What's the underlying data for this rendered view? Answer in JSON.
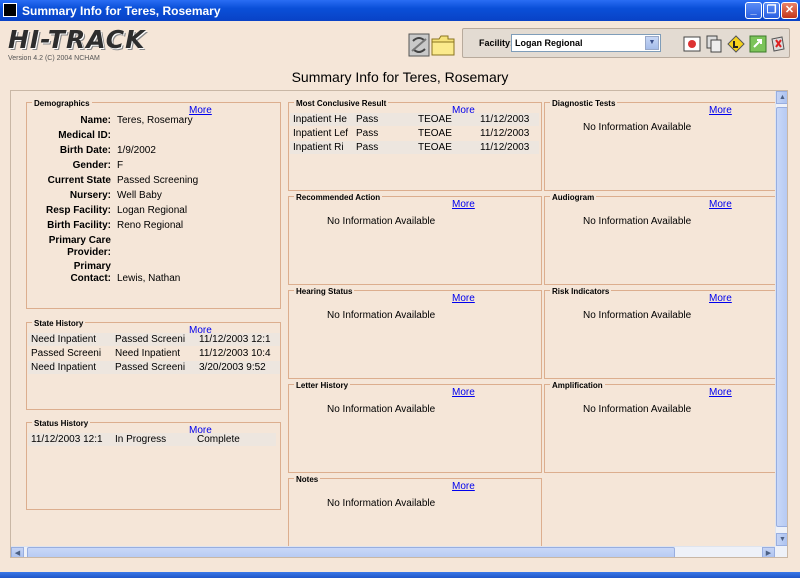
{
  "window": {
    "title": "Summary Info for Teres, Rosemary"
  },
  "header": {
    "logo": "HI-TRACK",
    "version": "Version 4.2   (C) 2004 NCHAM",
    "page_title": "Summary Info for Teres, Rosemary",
    "facility_label": "Facility:",
    "facility_value": "Logan Regional"
  },
  "more_label": "More",
  "no_info": "No Information Available",
  "demographics": {
    "title": "Demographics",
    "fields": [
      {
        "label": "Name:",
        "value": "Teres, Rosemary"
      },
      {
        "label": "Medical ID:",
        "value": ""
      },
      {
        "label": "Birth Date:",
        "value": "1/9/2002"
      },
      {
        "label": "Gender:",
        "value": "F"
      },
      {
        "label": "Current State",
        "value": "Passed Screening"
      },
      {
        "label": "Nursery:",
        "value": "Well Baby"
      },
      {
        "label": "Resp Facility:",
        "value": "Logan Regional"
      },
      {
        "label": "Birth Facility:",
        "value": "Reno  Regional"
      }
    ],
    "pcp_label_1": "Primary Care",
    "pcp_label_2": "Provider:",
    "pc_label_1": "Primary",
    "pc_label_2": "Contact:",
    "pc_value": "Lewis, Nathan"
  },
  "state_history": {
    "title": "State History",
    "rows": [
      [
        "Need Inpatient",
        "Passed Screeni",
        "11/12/2003 12:1"
      ],
      [
        "Passed Screeni",
        "Need Inpatient",
        "11/12/2003 10:4"
      ],
      [
        "Need Inpatient",
        "Passed Screeni",
        "3/20/2003 9:52"
      ]
    ]
  },
  "status_history": {
    "title": "Status History",
    "rows": [
      [
        "11/12/2003 12:1",
        "In Progress",
        "Complete"
      ]
    ]
  },
  "most_conclusive": {
    "title": "Most Conclusive Result",
    "rows": [
      [
        "Inpatient He",
        "Pass",
        "TEOAE",
        "11/12/2003"
      ],
      [
        "Inpatient Lef",
        "Pass",
        "TEOAE",
        "11/12/2003"
      ],
      [
        "Inpatient Ri",
        "Pass",
        "TEOAE",
        "11/12/2003"
      ]
    ]
  },
  "panels": {
    "recommended_action": "Recommended Action",
    "hearing_status": "Hearing Status",
    "letter_history": "Letter History",
    "notes": "Notes",
    "diagnostic_tests": "Diagnostic Tests",
    "audiogram": "Audiogram",
    "risk_indicators": "Risk Indicators",
    "amplification": "Amplification"
  },
  "colors": {
    "titlebar": "#0a4fd8",
    "background": "#f5e6d8",
    "panel_border": "#dcae8e",
    "link": "#0000ee"
  }
}
